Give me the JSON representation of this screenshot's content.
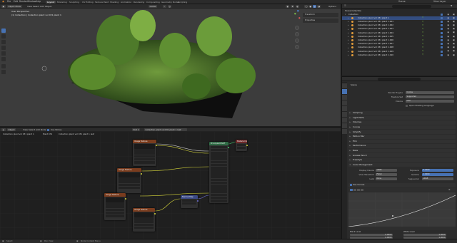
{
  "menubar": {
    "items": [
      "File",
      "Edit",
      "Render",
      "Window",
      "Help"
    ],
    "workspaces": [
      "Layout",
      "Modeling",
      "Sculpting",
      "UV Editing",
      "Texture Paint",
      "Shading",
      "Animation",
      "Rendering",
      "Compositing",
      "Geometry Nodes",
      "Scripting"
    ],
    "active_workspace": "Layout",
    "scene_label": "Scene",
    "view_layer_label": "View Layer"
  },
  "viewport": {
    "mode": "Object Mode",
    "menus": [
      "View",
      "Select",
      "Add",
      "Object"
    ],
    "transform": "Global",
    "overlay_title": "User Perspective",
    "overlay_subtitle": "(1) Collection | Collection plant vol 031 plant 1",
    "sidebar_tabs": [
      "Transform",
      "Properties"
    ],
    "options_label": "Options"
  },
  "outliner": {
    "title": "Scene Collection",
    "root": "Collection",
    "items": [
      "Collection plant vol 031 plant 1",
      "Collection plant vol 031 plant 1.001",
      "Collection plant vol 031 plant 1.002",
      "Collection plant vol 031 plant 1.003",
      "Collection plant vol 031 plant 1.004",
      "Collection plant vol 031 plant 1.005",
      "Collection plant vol 031 plant 1.006",
      "Collection plant vol 031 plant 1.007",
      "Collection plant vol 031 plant 1.008",
      "Collection plant vol 031 plant 1.009",
      "Collection plant vol 031 plant 1.010"
    ]
  },
  "properties": {
    "search_placeholder": "",
    "scene_label": "Scene",
    "render_engine_label": "Render Engine",
    "render_engine": "Cycles",
    "feature_set_label": "Feature Set",
    "feature_set": "Supported",
    "device_label": "Device",
    "device": "CPU",
    "osl_label": "Open Shading Language",
    "panels": [
      "Sampling",
      "Light Paths",
      "Volumes",
      "Curves",
      "Simplify",
      "Motion Blur",
      "Film",
      "Performance",
      "Bake",
      "Grease Pencil",
      "Freestyle",
      "Color Management"
    ],
    "cm": {
      "display_label": "Display Device",
      "display": "sRGB",
      "view_label": "View Transform",
      "view": "Filmic",
      "look_label": "Look",
      "look": "None",
      "exposure_label": "Exposure",
      "exposure": "0.2000",
      "gamma_label": "Gamma",
      "gamma": "1.0000",
      "sequencer_label": "Sequencer",
      "sequencer": "sRGB",
      "use_curves_label": "Use Curves"
    },
    "curve_footer": [
      "Black Level",
      "White Level"
    ],
    "curve_values": [
      "0.0000",
      "0.0000",
      "0.0000",
      "1.0000",
      "1.0000",
      "1.0000"
    ]
  },
  "node_editor": {
    "mode": "Object",
    "menus": [
      "View",
      "Select",
      "Add",
      "Node"
    ],
    "use_nodes_label": "Use Nodes",
    "slot": "Slot 1",
    "material": "Collection plant vol 031 plant 1 leaf",
    "breadcrumb": [
      "Collection plant vol 031 plant 1",
      "Plant 031",
      "Collection plant vol 031 plant 1 leaf"
    ],
    "nodes": [
      {
        "title": "Image Texture",
        "color": "#7a3c1e"
      },
      {
        "title": "Image Texture",
        "color": "#7a3c1e"
      },
      {
        "title": "Image Texture",
        "color": "#7a3c1e"
      },
      {
        "title": "Image Texture",
        "color": "#7a3c1e"
      },
      {
        "title": "Normal Map",
        "color": "#3b4a86"
      },
      {
        "title": "Principled BSDF",
        "color": "#2f6b45"
      },
      {
        "title": "Material Output",
        "color": "#6e2a2a"
      }
    ]
  },
  "statusbar": {
    "items": [
      "Select",
      "Pan View",
      "Node Context Menu"
    ]
  },
  "colors": {
    "accent": "#4772b3",
    "selected_row": "#334d80",
    "texture_header": "#7a3c1e",
    "shader_header": "#2f6b45",
    "output_header": "#6e2a2a"
  }
}
